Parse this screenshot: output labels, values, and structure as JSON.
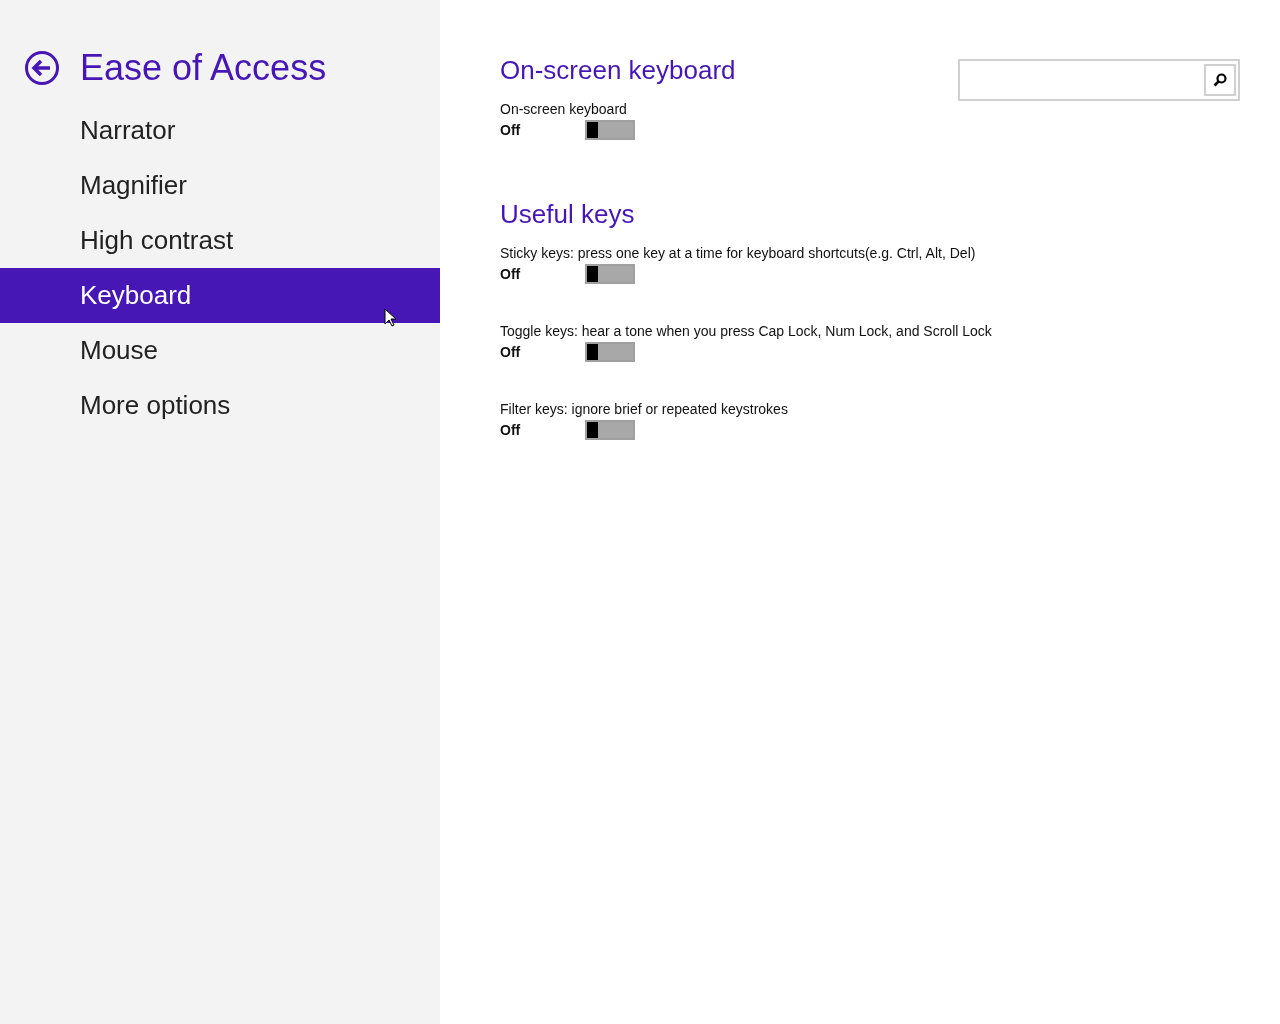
{
  "sidebar": {
    "title": "Ease of Access",
    "items": [
      {
        "label": "Narrator",
        "selected": false
      },
      {
        "label": "Magnifier",
        "selected": false
      },
      {
        "label": "High contrast",
        "selected": false
      },
      {
        "label": "Keyboard",
        "selected": true
      },
      {
        "label": "Mouse",
        "selected": false
      },
      {
        "label": "More options",
        "selected": false
      }
    ]
  },
  "sections": [
    {
      "title": "On-screen keyboard",
      "settings": [
        {
          "label": "On-screen keyboard",
          "state_text": "Off",
          "on": false
        }
      ]
    },
    {
      "title": "Useful keys",
      "settings": [
        {
          "label": "Sticky keys: press one key at a time for keyboard shortcuts(e.g. Ctrl, Alt, Del)",
          "state_text": "Off",
          "on": false
        },
        {
          "label": "Toggle keys: hear a tone when you press Cap Lock, Num Lock, and Scroll Lock",
          "state_text": "Off",
          "on": false
        },
        {
          "label": "Filter keys: ignore brief or repeated keystrokes",
          "state_text": "Off",
          "on": false
        }
      ]
    }
  ]
}
